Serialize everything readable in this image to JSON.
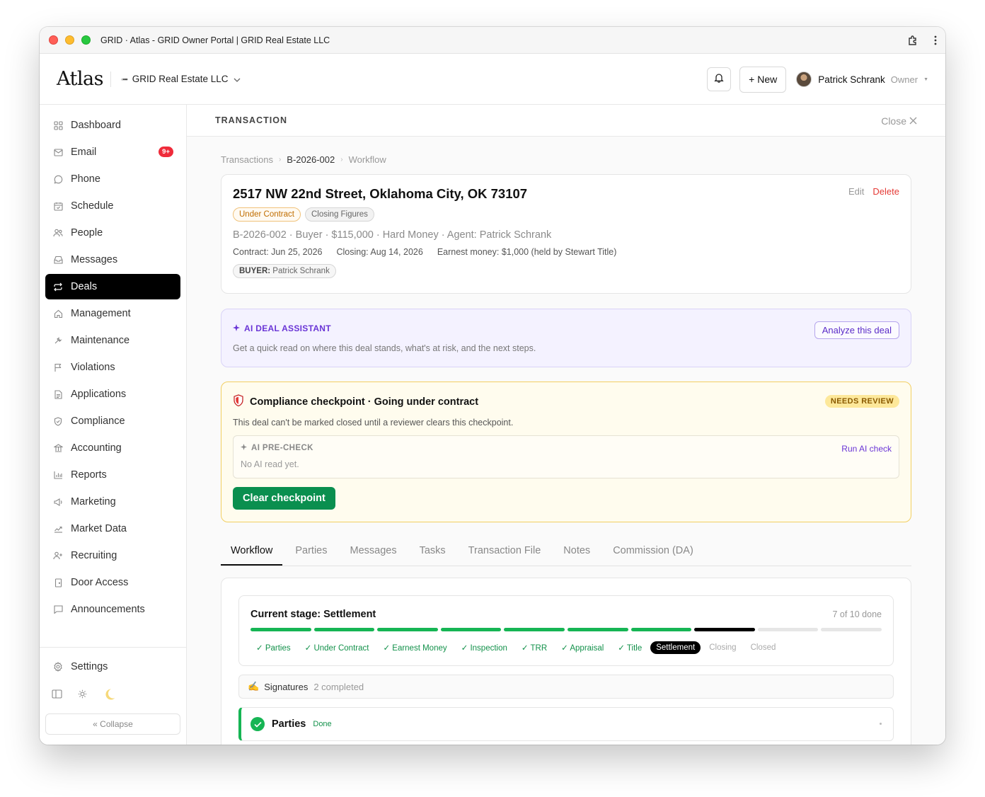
{
  "window": {
    "title": "GRID · Atlas - GRID Owner Portal | GRID Real Estate LLC"
  },
  "topbar": {
    "logo": "Atlas",
    "org_name": "GRID Real Estate LLC",
    "new_label": "+ New",
    "user_name": "Patrick Schrank",
    "user_role": "Owner"
  },
  "sidebar": {
    "items": [
      {
        "label": "Dashboard",
        "icon": "grid-icon"
      },
      {
        "label": "Email",
        "icon": "mail-icon",
        "badge": "9+"
      },
      {
        "label": "Phone",
        "icon": "phone-icon"
      },
      {
        "label": "Schedule",
        "icon": "calendar-icon"
      },
      {
        "label": "People",
        "icon": "people-icon"
      },
      {
        "label": "Messages",
        "icon": "inbox-icon"
      },
      {
        "label": "Deals",
        "icon": "repeat-icon",
        "active": true
      },
      {
        "label": "Management",
        "icon": "home-icon"
      },
      {
        "label": "Maintenance",
        "icon": "wrench-icon"
      },
      {
        "label": "Violations",
        "icon": "flag-icon"
      },
      {
        "label": "Applications",
        "icon": "file-icon"
      },
      {
        "label": "Compliance",
        "icon": "shield-icon"
      },
      {
        "label": "Accounting",
        "icon": "bank-icon"
      },
      {
        "label": "Reports",
        "icon": "bar-chart-icon"
      },
      {
        "label": "Marketing",
        "icon": "megaphone-icon"
      },
      {
        "label": "Market Data",
        "icon": "trend-icon"
      },
      {
        "label": "Recruiting",
        "icon": "user-plus-icon"
      },
      {
        "label": "Door Access",
        "icon": "door-icon"
      },
      {
        "label": "Announcements",
        "icon": "speech-icon"
      }
    ],
    "settings_label": "Settings",
    "collapse_label": "« Collapse"
  },
  "panel": {
    "title": "TRANSACTION",
    "close_label": "Close"
  },
  "breadcrumb": {
    "root": "Transactions",
    "id": "B-2026-002",
    "page": "Workflow"
  },
  "property": {
    "address": "2517 NW 22nd Street, Oklahoma City, OK 73107",
    "edit_label": "Edit",
    "delete_label": "Delete",
    "tag_status": "Under Contract",
    "tag_stage": "Closing Figures",
    "meta": "B-2026-002 · Buyer · $115,000 · Hard Money · Agent: Patrick Schrank",
    "contract": "Contract: Jun 25, 2026",
    "closing": "Closing: Aug 14, 2026",
    "earnest": "Earnest money: $1,000 (held by Stewart Title)",
    "buyer_key": "BUYER:",
    "buyer_name": "Patrick Schrank"
  },
  "ai_assistant": {
    "title": "AI DEAL ASSISTANT",
    "description": "Get a quick read on where this deal stands, what's at risk, and the next steps.",
    "button": "Analyze this deal"
  },
  "compliance": {
    "title": "Compliance checkpoint · Going under contract",
    "status": "NEEDS REVIEW",
    "description": "This deal can't be marked closed until a reviewer clears this checkpoint.",
    "precheck_title": "AI PRE-CHECK",
    "precheck_text": "No AI read yet.",
    "run_label": "Run AI check",
    "clear_label": "Clear checkpoint"
  },
  "tabs": [
    {
      "label": "Workflow",
      "active": true
    },
    {
      "label": "Parties"
    },
    {
      "label": "Messages"
    },
    {
      "label": "Tasks"
    },
    {
      "label": "Transaction File"
    },
    {
      "label": "Notes"
    },
    {
      "label": "Commission (DA)"
    }
  ],
  "workflow": {
    "stage_title": "Current stage: Settlement",
    "progress_text": "7 of 10 done",
    "progress_done": 7,
    "progress_total": 10,
    "stages": [
      {
        "label": "✓ Parties",
        "state": "done"
      },
      {
        "label": "✓ Under Contract",
        "state": "done"
      },
      {
        "label": "✓ Earnest Money",
        "state": "done"
      },
      {
        "label": "✓ Inspection",
        "state": "done"
      },
      {
        "label": "✓ TRR",
        "state": "done"
      },
      {
        "label": "✓ Appraisal",
        "state": "done"
      },
      {
        "label": "✓ Title",
        "state": "done"
      },
      {
        "label": "Settlement",
        "state": "current"
      },
      {
        "label": "Closing",
        "state": "todo"
      },
      {
        "label": "Closed",
        "state": "todo"
      }
    ],
    "signatures_label": "Signatures",
    "signatures_count": "2 completed",
    "parties_title": "Parties",
    "parties_status": "Done"
  },
  "colors": {
    "accent_green": "#16b554",
    "active_nav": "#000000",
    "danger": "#e53935",
    "ai_purple": "#6a35d6"
  }
}
